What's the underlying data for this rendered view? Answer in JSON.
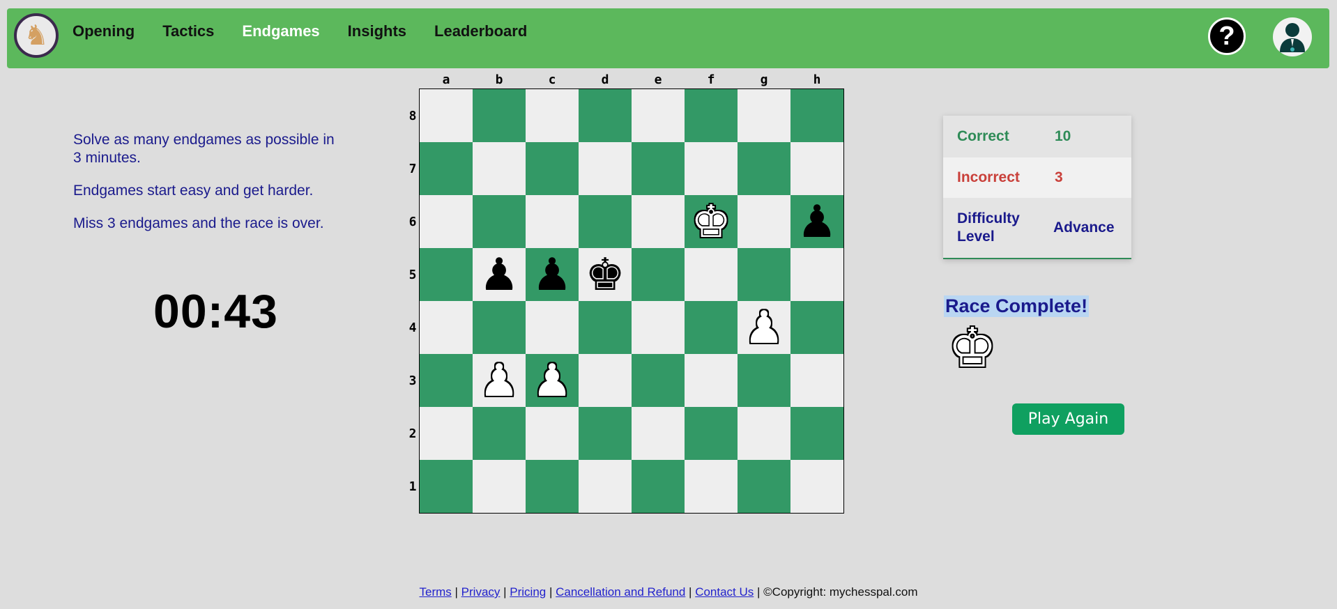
{
  "nav": {
    "logo_icon": "knight-icon",
    "links": [
      {
        "label": "Opening",
        "active": false
      },
      {
        "label": "Tactics",
        "active": false
      },
      {
        "label": "Endgames",
        "active": true
      },
      {
        "label": "Insights",
        "active": false
      },
      {
        "label": "Leaderboard",
        "active": false
      }
    ],
    "help_label": "?",
    "user_icon": "user-avatar-icon"
  },
  "info": {
    "lines": [
      "Solve as many endgames as possible in 3 minutes.",
      "Endgames start easy and get harder.",
      "Miss 3 endgames and the race is over."
    ]
  },
  "timer": "00:43",
  "board": {
    "files": [
      "a",
      "b",
      "c",
      "d",
      "e",
      "f",
      "g",
      "h"
    ],
    "ranks": [
      "8",
      "7",
      "6",
      "5",
      "4",
      "3",
      "2",
      "1"
    ],
    "pieces": {
      "f6": "K",
      "h6": "p",
      "b5": "p",
      "c5": "p",
      "d5": "k",
      "g4": "P",
      "b3": "P",
      "c3": "P"
    }
  },
  "score": {
    "correct_label": "Correct",
    "correct_value": "10",
    "incorrect_label": "Incorrect",
    "incorrect_value": "3",
    "difficulty_label": "Difficulty Level",
    "difficulty_value": "Advance"
  },
  "result": {
    "title": "Race Complete!",
    "piece": "K",
    "play_again_label": "Play Again"
  },
  "footer": {
    "links": [
      "Terms",
      "Privacy",
      "Pricing",
      "Cancellation and Refund",
      "Contact Us"
    ],
    "copyright": "©Copyright: mychesspal.com"
  },
  "colors": {
    "nav": "#5cb85c",
    "board_dark": "#339966",
    "board_light": "#eeeeee",
    "correct": "#2e8b57",
    "incorrect": "#c9403a",
    "text_blue": "#1a1a8c",
    "button": "#0fa060"
  }
}
